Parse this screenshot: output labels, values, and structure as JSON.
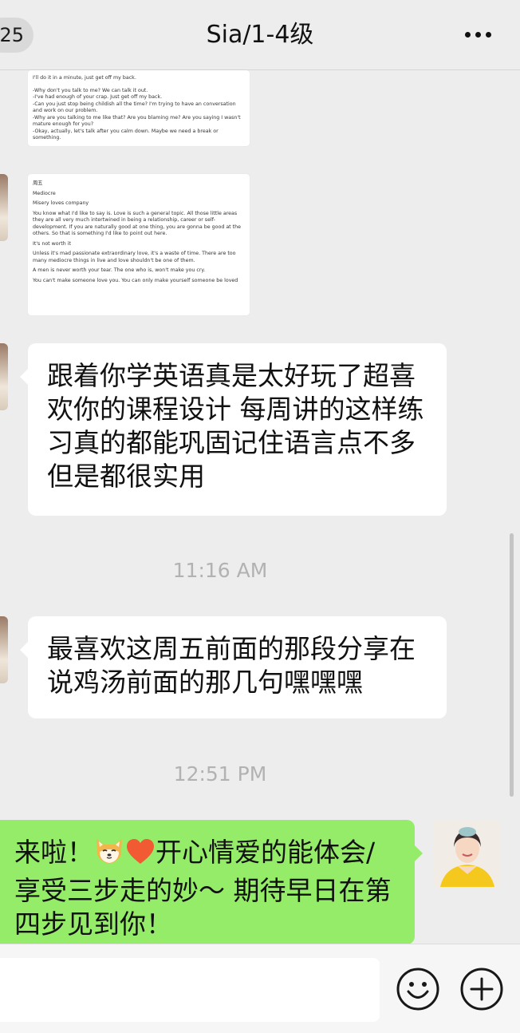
{
  "header": {
    "unread_count": "25",
    "title": "Sia/1-4级"
  },
  "doc1": {
    "lines": [
      "I'll do it in a minute, just get off my back.",
      "-Why don't you talk to me? We can talk it out.",
      "-I've had enough of your crap. Just get off my back.",
      "-Can you just stop being childish all the time? I'm trying to have an conversation and work on our problem.",
      "-Why are you talking to me like that? Are you blaming me? Are you saying I wasn't mature enough for you?",
      "-Okay, actually, let's talk after you calm down. Maybe we need a break or something."
    ]
  },
  "doc2": {
    "day": "周五",
    "heading": "Mediocre",
    "subheading": "Misery loves company",
    "p1": "You know what I'd like to say is. Love is such a general topic. All those little areas they are all very much intertwined in being a relationship, career or self-development. If you are naturally good at one thing, you are gonna be good at the others. So that is something I'd like to point out here.",
    "p2": "It's not worth it",
    "p3": "Unless it's mad passionate extraordinary love, it's a waste of time. There are too many mediocre things in live and love shouldn't be one of them.",
    "p4": "A men is never worth your tear. The one who is, won't make you cry.",
    "p5": "You can't make someone love you. You can only make yourself someone be loved"
  },
  "messages": {
    "m1": "跟着你学英语真是太好玩了超喜欢你的课程设计 每周讲的这样练习真的都能巩固记住语言点不多但是都很实用",
    "t1": "11:16 AM",
    "m2": "最喜欢这周五前面的那段分享在说鸡汤前面的那几句嘿嘿嘿",
    "t2": "12:51 PM",
    "m3_a": "来啦！",
    "m3_b": "开心情爱的能体会/享受三步走的妙～ 期待早日在第四步见到你！"
  },
  "icons": {
    "back": "back-badge",
    "more": "more-icon",
    "emoji_button": "smiley-icon",
    "plus_button": "plus-icon",
    "sticker": "shiba-dog-emoji",
    "heart": "red-heart-emoji"
  },
  "colors": {
    "background": "#ededed",
    "incoming_bubble": "#ffffff",
    "outgoing_bubble": "#95ec69",
    "timestamp": "#b2b2b2"
  }
}
